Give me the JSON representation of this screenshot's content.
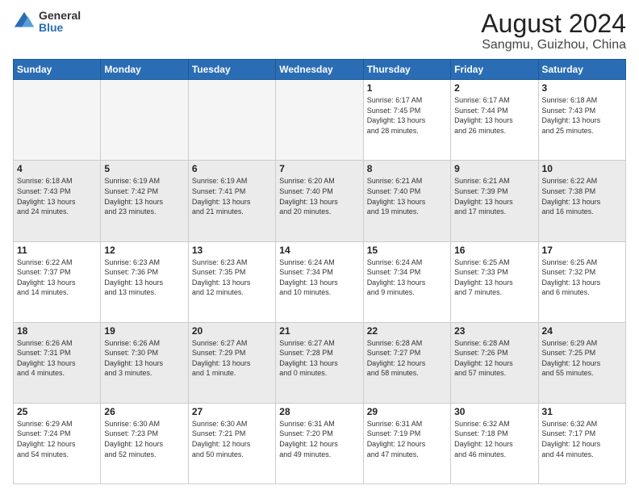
{
  "logo": {
    "general": "General",
    "blue": "Blue"
  },
  "title": "August 2024",
  "subtitle": "Sangmu, Guizhou, China",
  "days_of_week": [
    "Sunday",
    "Monday",
    "Tuesday",
    "Wednesday",
    "Thursday",
    "Friday",
    "Saturday"
  ],
  "weeks": [
    [
      {
        "day": "",
        "info": "",
        "empty": true
      },
      {
        "day": "",
        "info": "",
        "empty": true
      },
      {
        "day": "",
        "info": "",
        "empty": true
      },
      {
        "day": "",
        "info": "",
        "empty": true
      },
      {
        "day": "1",
        "info": "Sunrise: 6:17 AM\nSunset: 7:45 PM\nDaylight: 13 hours\nand 28 minutes."
      },
      {
        "day": "2",
        "info": "Sunrise: 6:17 AM\nSunset: 7:44 PM\nDaylight: 13 hours\nand 26 minutes."
      },
      {
        "day": "3",
        "info": "Sunrise: 6:18 AM\nSunset: 7:43 PM\nDaylight: 13 hours\nand 25 minutes."
      }
    ],
    [
      {
        "day": "4",
        "info": "Sunrise: 6:18 AM\nSunset: 7:43 PM\nDaylight: 13 hours\nand 24 minutes."
      },
      {
        "day": "5",
        "info": "Sunrise: 6:19 AM\nSunset: 7:42 PM\nDaylight: 13 hours\nand 23 minutes."
      },
      {
        "day": "6",
        "info": "Sunrise: 6:19 AM\nSunset: 7:41 PM\nDaylight: 13 hours\nand 21 minutes."
      },
      {
        "day": "7",
        "info": "Sunrise: 6:20 AM\nSunset: 7:40 PM\nDaylight: 13 hours\nand 20 minutes."
      },
      {
        "day": "8",
        "info": "Sunrise: 6:21 AM\nSunset: 7:40 PM\nDaylight: 13 hours\nand 19 minutes."
      },
      {
        "day": "9",
        "info": "Sunrise: 6:21 AM\nSunset: 7:39 PM\nDaylight: 13 hours\nand 17 minutes."
      },
      {
        "day": "10",
        "info": "Sunrise: 6:22 AM\nSunset: 7:38 PM\nDaylight: 13 hours\nand 16 minutes."
      }
    ],
    [
      {
        "day": "11",
        "info": "Sunrise: 6:22 AM\nSunset: 7:37 PM\nDaylight: 13 hours\nand 14 minutes."
      },
      {
        "day": "12",
        "info": "Sunrise: 6:23 AM\nSunset: 7:36 PM\nDaylight: 13 hours\nand 13 minutes."
      },
      {
        "day": "13",
        "info": "Sunrise: 6:23 AM\nSunset: 7:35 PM\nDaylight: 13 hours\nand 12 minutes."
      },
      {
        "day": "14",
        "info": "Sunrise: 6:24 AM\nSunset: 7:34 PM\nDaylight: 13 hours\nand 10 minutes."
      },
      {
        "day": "15",
        "info": "Sunrise: 6:24 AM\nSunset: 7:34 PM\nDaylight: 13 hours\nand 9 minutes."
      },
      {
        "day": "16",
        "info": "Sunrise: 6:25 AM\nSunset: 7:33 PM\nDaylight: 13 hours\nand 7 minutes."
      },
      {
        "day": "17",
        "info": "Sunrise: 6:25 AM\nSunset: 7:32 PM\nDaylight: 13 hours\nand 6 minutes."
      }
    ],
    [
      {
        "day": "18",
        "info": "Sunrise: 6:26 AM\nSunset: 7:31 PM\nDaylight: 13 hours\nand 4 minutes."
      },
      {
        "day": "19",
        "info": "Sunrise: 6:26 AM\nSunset: 7:30 PM\nDaylight: 13 hours\nand 3 minutes."
      },
      {
        "day": "20",
        "info": "Sunrise: 6:27 AM\nSunset: 7:29 PM\nDaylight: 13 hours\nand 1 minute."
      },
      {
        "day": "21",
        "info": "Sunrise: 6:27 AM\nSunset: 7:28 PM\nDaylight: 13 hours\nand 0 minutes."
      },
      {
        "day": "22",
        "info": "Sunrise: 6:28 AM\nSunset: 7:27 PM\nDaylight: 12 hours\nand 58 minutes."
      },
      {
        "day": "23",
        "info": "Sunrise: 6:28 AM\nSunset: 7:26 PM\nDaylight: 12 hours\nand 57 minutes."
      },
      {
        "day": "24",
        "info": "Sunrise: 6:29 AM\nSunset: 7:25 PM\nDaylight: 12 hours\nand 55 minutes."
      }
    ],
    [
      {
        "day": "25",
        "info": "Sunrise: 6:29 AM\nSunset: 7:24 PM\nDaylight: 12 hours\nand 54 minutes."
      },
      {
        "day": "26",
        "info": "Sunrise: 6:30 AM\nSunset: 7:23 PM\nDaylight: 12 hours\nand 52 minutes."
      },
      {
        "day": "27",
        "info": "Sunrise: 6:30 AM\nSunset: 7:21 PM\nDaylight: 12 hours\nand 50 minutes."
      },
      {
        "day": "28",
        "info": "Sunrise: 6:31 AM\nSunset: 7:20 PM\nDaylight: 12 hours\nand 49 minutes."
      },
      {
        "day": "29",
        "info": "Sunrise: 6:31 AM\nSunset: 7:19 PM\nDaylight: 12 hours\nand 47 minutes."
      },
      {
        "day": "30",
        "info": "Sunrise: 6:32 AM\nSunset: 7:18 PM\nDaylight: 12 hours\nand 46 minutes."
      },
      {
        "day": "31",
        "info": "Sunrise: 6:32 AM\nSunset: 7:17 PM\nDaylight: 12 hours\nand 44 minutes."
      }
    ]
  ]
}
